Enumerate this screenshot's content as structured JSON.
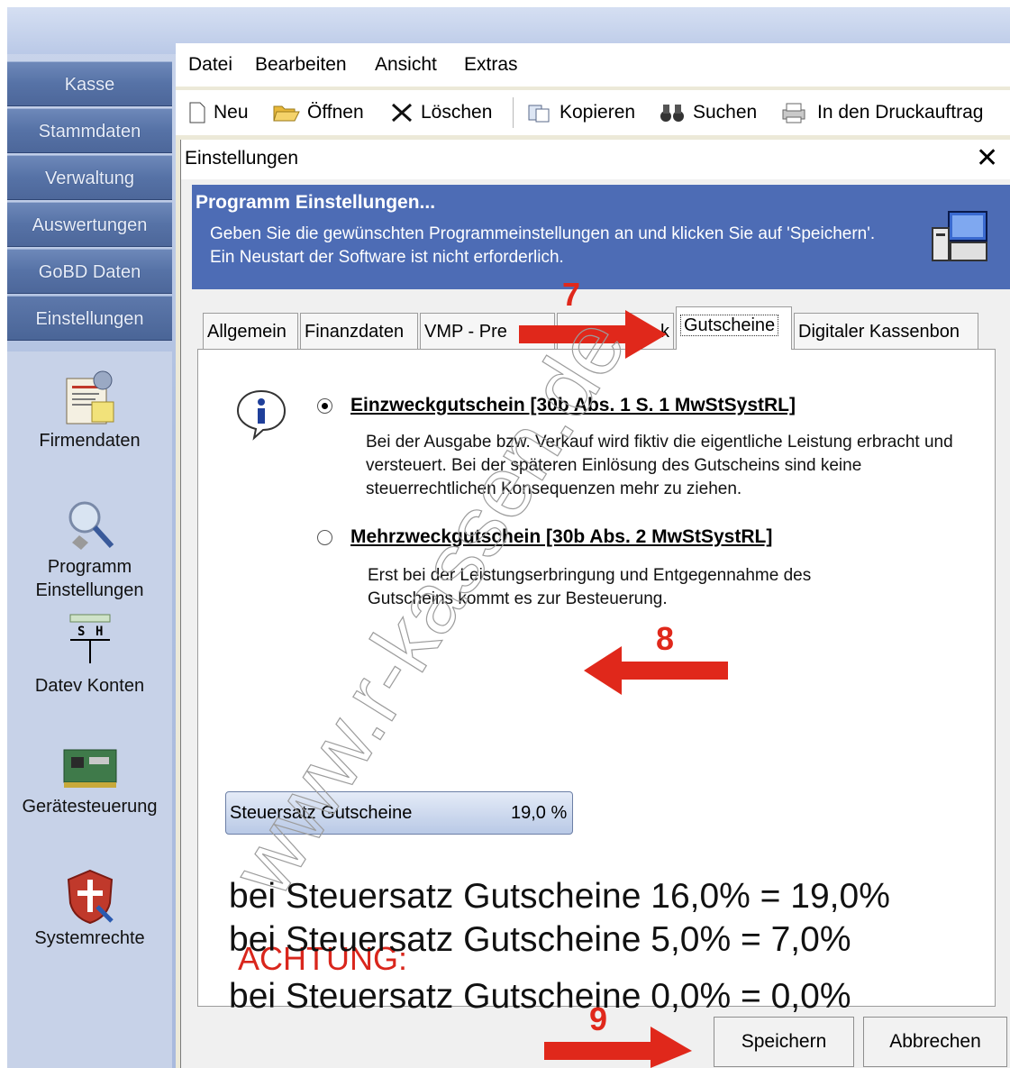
{
  "sidebar": {
    "nav": [
      "Kasse",
      "Stammdaten",
      "Verwaltung",
      "Auswertungen",
      "GoBD Daten",
      "Einstellungen"
    ],
    "tools": [
      {
        "label": "Firmendaten",
        "icon": "company-data-icon"
      },
      {
        "label": "Programm Einstellungen",
        "icon": "program-settings-icon"
      },
      {
        "label": "Datev Konten",
        "icon": "datev-accounts-icon"
      },
      {
        "label": "Gerätesteuerung",
        "icon": "device-control-icon"
      },
      {
        "label": "Systemrechte",
        "icon": "system-rights-icon"
      }
    ]
  },
  "menu": {
    "items": [
      "Datei",
      "Bearbeiten",
      "Ansicht",
      "Extras"
    ]
  },
  "toolbar": {
    "new_label": "Neu",
    "open_label": "Öffnen",
    "delete_label": "Löschen",
    "copy_label": "Kopieren",
    "search_label": "Suchen",
    "print_label": "In den Druckauftrag"
  },
  "dialog": {
    "title": "Einstellungen",
    "header_title": "Programm Einstellungen...",
    "header_text": "Geben Sie die gewünschten Programmeinstellungen an und klicken Sie auf 'Speichern'. Ein Neustart der Software ist nicht erforderlich.",
    "tabs": [
      "Allgemein",
      "Finanzdaten",
      "VMP - Pre",
      "k",
      "Gutscheine",
      "Digitaler Kassenbon"
    ],
    "active_tab": "Gutscheine",
    "option1_label": "Einzweckgutschein [30b Abs. 1 S. 1 MwStSystRL]",
    "option1_desc": "Bei der Ausgabe bzw. Verkauf wird fiktiv die eigentliche Leistung erbracht und versteuert. Bei der späteren Einlösung des Gutscheins sind keine steuerrechtlichen Konsequenzen mehr zu ziehen.",
    "option2_label": "Mehrzweckgutschein [30b Abs. 2 MwStSystRL]",
    "option2_desc": "Erst bei der Leistungserbringung und Entgegennahme des Gutscheins kommt es zur Besteuerung.",
    "selected_option": "Einzweckgutschein",
    "tax_label": "Steuersatz Gutscheine",
    "tax_value": "19,0 %",
    "save_label": "Speichern",
    "cancel_label": "Abbrechen"
  },
  "annotations": {
    "step7": "7",
    "step8": "8",
    "step9": "9",
    "warning_title": "ACHTUNG:",
    "warning_lines": [
      "bei Steuersatz Gutscheine 0,0% = 0,0%",
      "bei Steuersatz Gutscheine 16,0% = 19,0%",
      "bei Steuersatz Gutscheine 5,0% = 7,0%"
    ],
    "arrow_color": "#e0281b",
    "watermark": "www.r-kassen.de"
  },
  "colors": {
    "header_blue": "#4d6cb5",
    "sidebar_blue": "#5672a6",
    "annotation_red": "#e0281b"
  }
}
